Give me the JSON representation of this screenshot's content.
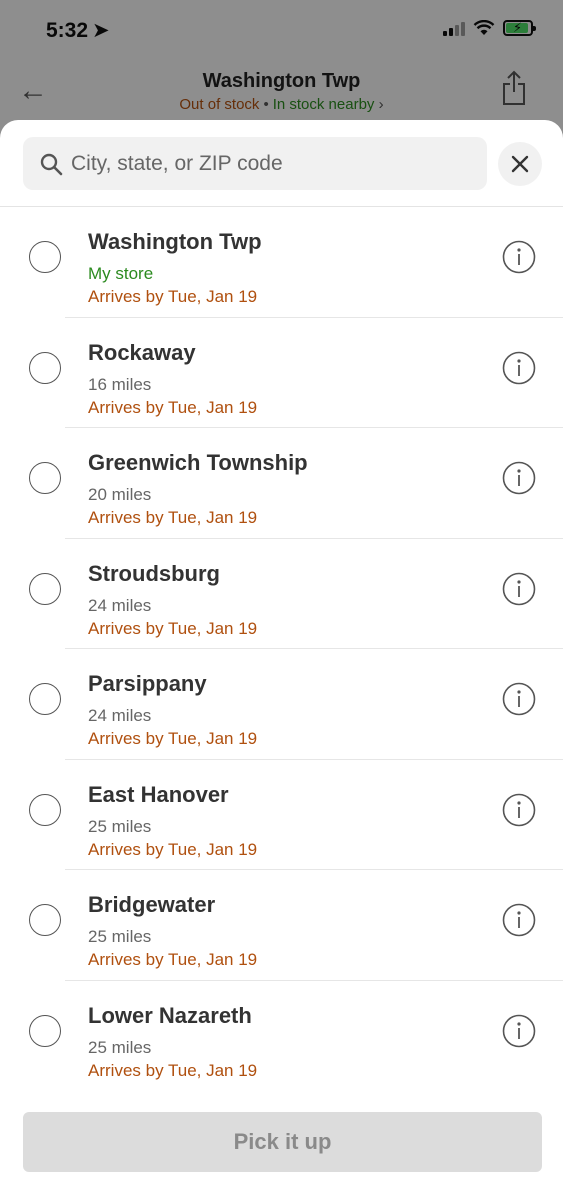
{
  "status_bar": {
    "time": "5:32",
    "location_icon": "location-arrow-icon",
    "battery_color": "#4cd964"
  },
  "header": {
    "title": "Washington Twp",
    "out_of_stock": "Out of stock",
    "separator": "•",
    "in_stock_nearby": "In stock nearby",
    "chevron": "›",
    "back_icon": "back-arrow-icon",
    "share_icon": "share-icon"
  },
  "search": {
    "placeholder": "City, state, or ZIP code",
    "value": ""
  },
  "stores": [
    {
      "name": "Washington Twp",
      "detail": "My store",
      "arrival": "Arrives by Tue, Jan 19"
    },
    {
      "name": "Rockaway",
      "detail": "16 miles",
      "arrival": "Arrives by Tue, Jan 19"
    },
    {
      "name": "Greenwich Township",
      "detail": "20 miles",
      "arrival": "Arrives by Tue, Jan 19"
    },
    {
      "name": "Stroudsburg",
      "detail": "24 miles",
      "arrival": "Arrives by Tue, Jan 19"
    },
    {
      "name": "Parsippany",
      "detail": "24 miles",
      "arrival": "Arrives by Tue, Jan 19"
    },
    {
      "name": "East Hanover",
      "detail": "25 miles",
      "arrival": "Arrives by Tue, Jan 19"
    },
    {
      "name": "Bridgewater",
      "detail": "25 miles",
      "arrival": "Arrives by Tue, Jan 19"
    },
    {
      "name": "Lower Nazareth",
      "detail": "25 miles",
      "arrival": "Arrives by Tue, Jan 19"
    }
  ],
  "pick_button": {
    "label": "Pick it up"
  },
  "colors": {
    "accent_orange": "#b0500f",
    "accent_green": "#2b8a1f"
  }
}
